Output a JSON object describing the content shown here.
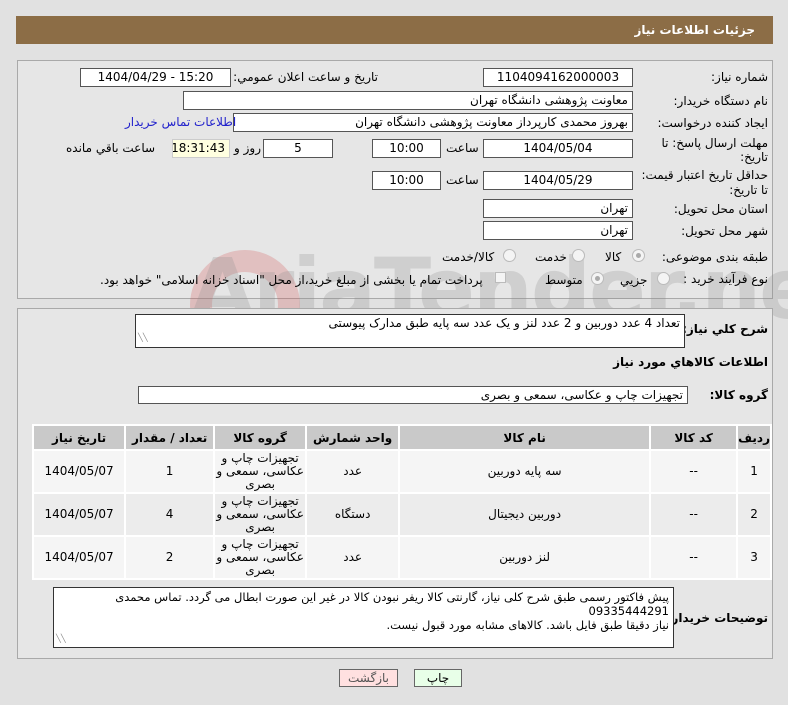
{
  "header": {
    "title": "جزئیات اطلاعات نیاز"
  },
  "form": {
    "need_number_label": "شماره نیاز:",
    "need_number": "1104094162000003",
    "announce_label": "تاریخ و ساعت اعلان عمومي:",
    "announce_value": "1404/04/29 - 15:20",
    "buyer_org_label": "نام دستگاه خريدار:",
    "buyer_org": "معاونت پژوهشی دانشگاه تهران",
    "requester_label": "ایجاد کننده درخواست:",
    "requester": "بهروز محمدی کارپرداز معاونت پژوهشی دانشگاه تهران",
    "contact_link": "اطلاعات تماس خریدار",
    "deadline_label_1": "مهلت ارسال پاسخ: تا",
    "deadline_label_2": "تاریخ:",
    "deadline_date": "1404/05/04",
    "time_label": "ساعت",
    "deadline_time": "10:00",
    "days": "5",
    "days_label": "روز و",
    "remaining": "18:31:43",
    "remaining_label": "ساعت باقي مانده",
    "validity_label_1": "حداقل تاریخ اعتبار قیمت:",
    "validity_label_2": "تا تاریخ:",
    "validity_date": "1404/05/29",
    "validity_time": "10:00",
    "province_label": "استان محل تحویل:",
    "province": "تهران",
    "city_label": "شهر محل تحویل:",
    "city": "تهران",
    "category_label": "طبقه بندی موضوعی:",
    "category_options": [
      "کالا",
      "خدمت",
      "کالا/خدمت"
    ],
    "process_label": "نوع فرآیند خرید :",
    "process_options": [
      "جزیي",
      "متوسط"
    ],
    "treasury_note": "پرداخت تمام یا بخشی از مبلغ خرید،از محل \"اسناد خزانه اسلامی\" خواهد بود."
  },
  "details": {
    "description_label": "شرح كلي نياز:",
    "description": "تعداد 4 عدد دوربین و 2 عدد لنز و یک عدد سه پایه طبق مدارک پیوستی",
    "items_title": "اطلاعات كالاهاي مورد نياز",
    "group_label": "گروه کالا:",
    "group": "تجهیزات چاپ و عکاسی، سمعی و بصری",
    "columns": [
      "ردیف",
      "کد کالا",
      "نام کالا",
      "واحد شمارش",
      "گروه کالا",
      "تعداد / مقدار",
      "تاریخ نیاز"
    ],
    "rows": [
      {
        "idx": "1",
        "code": "--",
        "name": "سه پایه دوربین",
        "unit": "عدد",
        "group": "تجهیزات چاپ و عکاسی، سمعی و بصری",
        "qty": "1",
        "date": "1404/05/07"
      },
      {
        "idx": "2",
        "code": "--",
        "name": "دوربین دیجیتال",
        "unit": "دستگاه",
        "group": "تجهیزات چاپ و عکاسی، سمعی و بصری",
        "qty": "4",
        "date": "1404/05/07"
      },
      {
        "idx": "3",
        "code": "--",
        "name": "لنز دوربین",
        "unit": "عدد",
        "group": "تجهیزات چاپ و عکاسی، سمعی و بصری",
        "qty": "2",
        "date": "1404/05/07"
      }
    ],
    "buyer_notes_label": "توضیحات خریدار:",
    "buyer_notes_1": "پیش فاکتور رسمی طبق شرح کلی نیاز، گارنتی کالا ریفر نبودن کالا در غیر این صورت ابطال می گردد. تماس محمدی",
    "buyer_notes_2": "09335444291",
    "buyer_notes_3": "نیاز دقیقا طبق فایل باشد. کالاهای مشابه مورد قبول نیست."
  },
  "buttons": {
    "print": "چاپ",
    "back": "بازگشت"
  },
  "colors": {
    "header": "#8c6d46",
    "link": "#2222cc",
    "print_bg": "#e8ffe8",
    "back_bg": "#ffe0e0",
    "remaining_bg": "#ffffe0"
  }
}
